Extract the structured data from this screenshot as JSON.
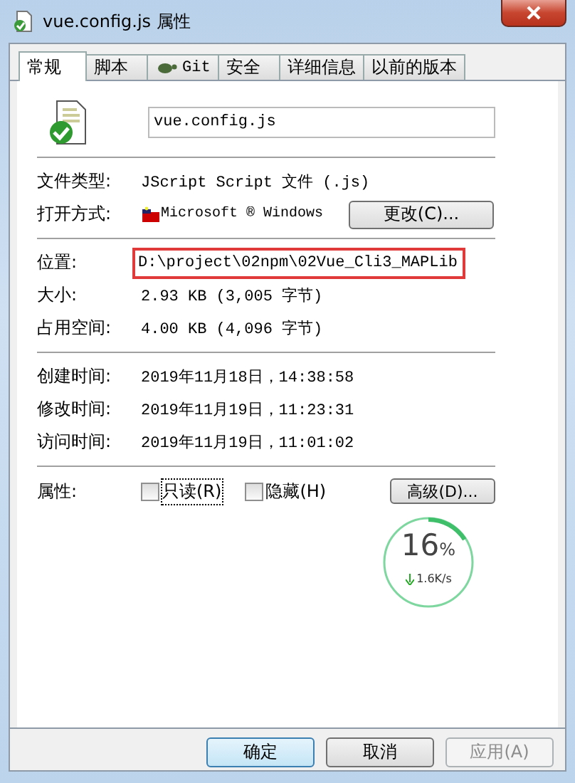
{
  "window": {
    "title": "vue.config.js 属性"
  },
  "tabs": [
    {
      "label": "常规",
      "selected": true
    },
    {
      "label": "脚本",
      "selected": false
    },
    {
      "label": "Git",
      "selected": false,
      "kind": "git"
    },
    {
      "label": "安全",
      "selected": false
    },
    {
      "label": "详细信息",
      "selected": false
    },
    {
      "label": "以前的版本",
      "selected": false
    }
  ],
  "file_name": {
    "value": "vue.config.js"
  },
  "sections": [
    [
      {
        "label": "文件类型:",
        "value": "JScript Script 文件 (.js)"
      },
      {
        "label": "打开方式:",
        "value": "Microsoft ® Windows",
        "kind": "opener",
        "button": "更改(C)..."
      }
    ],
    [
      {
        "label": "位置:",
        "value": "D:\\project\\02npm\\02Vue_Cli3_MAPLib",
        "highlighted": true
      },
      {
        "label": "大小:",
        "value": "2.93 KB (3,005 字节)"
      },
      {
        "label": "占用空间:",
        "value": "4.00 KB (4,096 字节)"
      }
    ],
    [
      {
        "label": "创建时间:",
        "value": "2019年11月18日，14:38:58"
      },
      {
        "label": "修改时间:",
        "value": "2019年11月19日，11:23:31"
      },
      {
        "label": "访问时间:",
        "value": "2019年11月19日，11:01:02"
      }
    ]
  ],
  "attributes": {
    "label": "属性:",
    "checkboxes": [
      {
        "label": "只读(R)",
        "checked": false
      },
      {
        "label": "隐藏(H)",
        "checked": false
      }
    ],
    "button": "高级(D)..."
  },
  "speed_widget": {
    "percent": "16",
    "unit": "%",
    "level": 0.16,
    "speed": "1.6K/s"
  },
  "buttons": [
    {
      "label": "确定",
      "disabled": false,
      "default": true
    },
    {
      "label": "取消",
      "disabled": false,
      "default": false
    },
    {
      "label": "应用(A)",
      "disabled": true,
      "default": false
    }
  ]
}
